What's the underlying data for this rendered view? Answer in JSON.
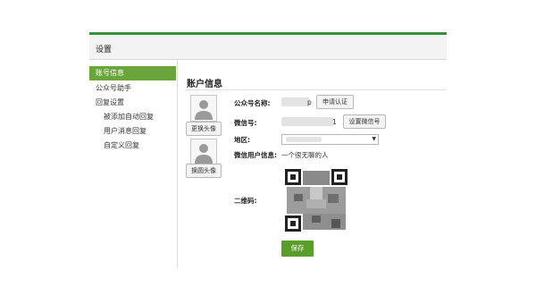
{
  "header": {
    "title": "设置"
  },
  "sidebar": {
    "items": [
      {
        "label": "账号信息"
      },
      {
        "label": "公众号助手"
      },
      {
        "label": "回复设置"
      },
      {
        "label": "被添加自动回复"
      },
      {
        "label": "用户消息回复"
      },
      {
        "label": "自定义回复"
      }
    ]
  },
  "main": {
    "title": "账户信息",
    "avatar_buttons": {
      "change": "更换头像",
      "round": "换圆头像"
    },
    "fields": {
      "name": {
        "label": "公众号名称:",
        "suffix": "p",
        "button": "申请认证"
      },
      "wechat": {
        "label": "微信号:",
        "suffix": "1",
        "button": "设置微信号"
      },
      "region": {
        "label": "地区:"
      },
      "signature": {
        "label": "微信用户信息:",
        "value": "一个很无聊的人"
      },
      "qrcode": {
        "label": "二维码:"
      }
    },
    "save_label": "保存"
  },
  "colors": {
    "accent": "#6aa53b",
    "save": "#5a9e2a"
  }
}
